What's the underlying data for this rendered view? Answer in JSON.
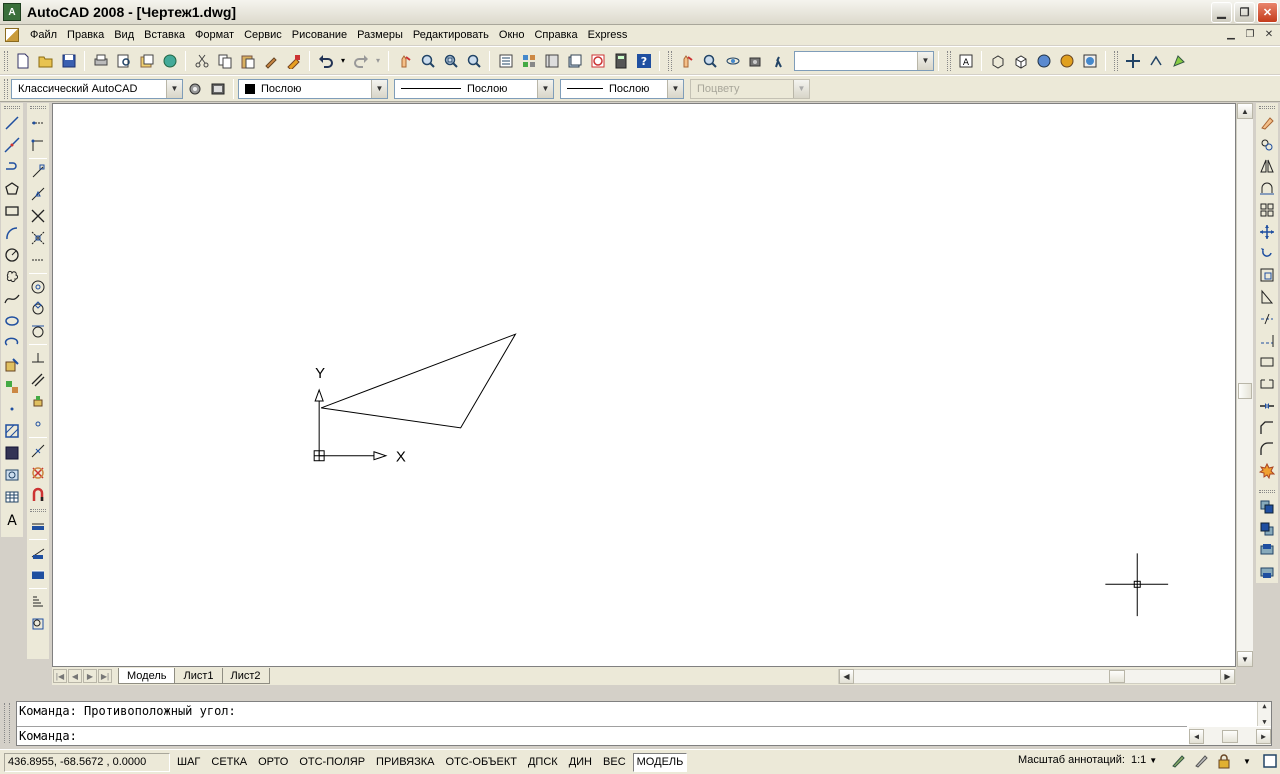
{
  "window": {
    "title": "AutoCAD 2008 - [Чертеж1.dwg]",
    "app_icon_glyph": "A"
  },
  "menu": [
    "Файл",
    "Правка",
    "Вид",
    "Вставка",
    "Формат",
    "Сервис",
    "Рисование",
    "Размеры",
    "Редактировать",
    "Окно",
    "Справка",
    "Express"
  ],
  "toolbar": {
    "workspace": "Классический AutoCAD",
    "color": "Послою",
    "linetype": "Послою",
    "lineweight": "Послою",
    "plotstyle": "Поцвету",
    "named_view": ""
  },
  "drawing": {
    "ucs_x_label": "X",
    "ucs_y_label": "Y"
  },
  "tabs": [
    "Модель",
    "Лист1",
    "Лист2"
  ],
  "command": {
    "history": "Команда: Противоположный угол:",
    "prompt": "Команда:"
  },
  "status": {
    "coordinates": "436.8955, -68.5672 , 0.0000",
    "toggles": [
      {
        "label": "ШАГ",
        "on": false
      },
      {
        "label": "СЕТКА",
        "on": false
      },
      {
        "label": "ОРТО",
        "on": false
      },
      {
        "label": "ОТС-ПОЛЯР",
        "on": false
      },
      {
        "label": "ПРИВЯЗКА",
        "on": false
      },
      {
        "label": "ОТС-ОБЪЕКТ",
        "on": false
      },
      {
        "label": "ДПСК",
        "on": false
      },
      {
        "label": "ДИН",
        "on": false
      },
      {
        "label": "ВЕС",
        "on": false
      },
      {
        "label": "МОДЕЛЬ",
        "on": true
      }
    ],
    "annotation_scale_label": "Масштаб аннотаций:",
    "annotation_scale_value": "1:1"
  },
  "colors": {
    "canvas": "#ffffff",
    "chrome": "#ece9d8",
    "ink": "#000000"
  }
}
